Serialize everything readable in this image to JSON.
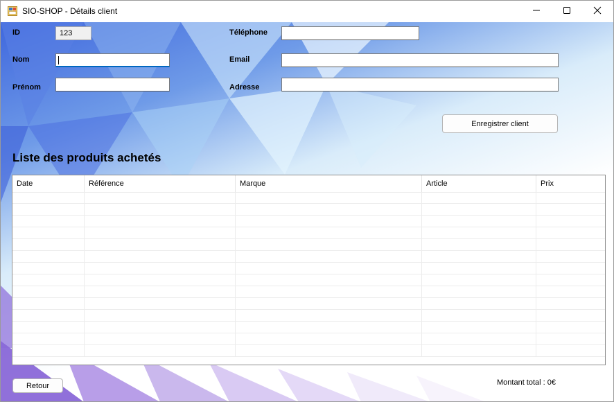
{
  "window": {
    "title": "SIO-SHOP - Détails client",
    "controls": [
      "minimize-icon",
      "maximize-icon",
      "close-icon"
    ]
  },
  "form": {
    "id_label": "ID",
    "id_value": "123",
    "nom_label": "Nom",
    "nom_value": "",
    "prenom_label": "Prénom",
    "prenom_value": "",
    "telephone_label": "Téléphone",
    "telephone_value": "",
    "email_label": "Email",
    "email_value": "",
    "adresse_label": "Adresse",
    "adresse_value": "",
    "save_button": "Enregistrer client"
  },
  "purchases": {
    "title": "Liste des produits achetés",
    "columns": [
      "Date",
      "Référence",
      "Marque",
      "Article",
      "Prix"
    ],
    "rows": []
  },
  "footer": {
    "back_button": "Retour",
    "total_text": "Montant total : 0€"
  },
  "colors": {
    "accent": "#0067c0",
    "background_blue": "#3f67dd",
    "background_purple": "#7b5bd6"
  }
}
